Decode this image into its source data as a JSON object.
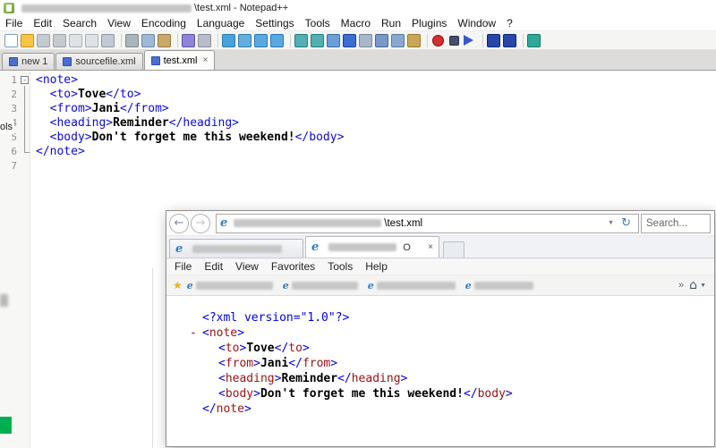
{
  "window": {
    "title_suffix": "\\test.xml - Notepad++"
  },
  "npp": {
    "menus": [
      "File",
      "Edit",
      "Search",
      "View",
      "Encoding",
      "Language",
      "Settings",
      "Tools",
      "Macro",
      "Run",
      "Plugins",
      "Window",
      "?"
    ],
    "toolbar": [
      {
        "name": "new-file",
        "c": "#fefefe",
        "b": "#7f9db9"
      },
      {
        "name": "open-folder",
        "c": "#f7c645",
        "b": "#c89018"
      },
      {
        "name": "save",
        "c": "#c4cad0",
        "b": "#9aa2aa"
      },
      {
        "name": "save-all",
        "c": "#c4cad0",
        "b": "#9aa2aa"
      },
      {
        "name": "close",
        "c": "#dfe3e7",
        "b": "#a8b0b8"
      },
      {
        "name": "close-all",
        "c": "#dfe3e7",
        "b": "#a8b0b8"
      },
      {
        "name": "print",
        "c": "#bfcad4",
        "b": "#8c98a4"
      },
      {
        "sep": true
      },
      {
        "name": "cut",
        "c": "#aab4bd",
        "b": "#7e8890"
      },
      {
        "name": "copy",
        "c": "#9fb8d8",
        "b": "#6f88a8"
      },
      {
        "name": "paste",
        "c": "#c9a86a",
        "b": "#987840"
      },
      {
        "sep": true
      },
      {
        "name": "undo",
        "c": "#8f84d8",
        "b": "#5f54a8"
      },
      {
        "name": "redo",
        "c": "#b9bdc9",
        "b": "#898d99"
      },
      {
        "sep": true
      },
      {
        "name": "find",
        "c": "#4aa3d8",
        "b": "#2a7ba8"
      },
      {
        "name": "replace",
        "c": "#63aede",
        "b": "#337ea8"
      },
      {
        "name": "zoom-in",
        "c": "#5aa8e0",
        "b": "#2a78b0"
      },
      {
        "name": "zoom-out",
        "c": "#5aa8e0",
        "b": "#2a78b0"
      },
      {
        "sep": true
      },
      {
        "name": "sync-vertical-scroll",
        "c": "#52b0b0",
        "b": "#228080"
      },
      {
        "name": "sync-horizontal-scroll",
        "c": "#52b0b0",
        "b": "#228080"
      },
      {
        "name": "word-wrap",
        "c": "#6a9fd8",
        "b": "#3a6fa8"
      },
      {
        "name": "show-all-characters",
        "c": "#3a6fd0",
        "b": "#1a3fa0"
      },
      {
        "name": "indent-guide",
        "c": "#a8b8c8",
        "b": "#788898"
      },
      {
        "name": "document-map",
        "c": "#7898c8",
        "b": "#486898"
      },
      {
        "name": "function-list",
        "c": "#88a8d0",
        "b": "#5878a0"
      },
      {
        "name": "folder-as-workspace",
        "c": "#c8a858",
        "b": "#987828"
      },
      {
        "sep": true
      },
      {
        "name": "macro-record",
        "c": "#d03030",
        "b": "#a00000",
        "shape": "circle"
      },
      {
        "name": "macro-stop",
        "c": "#46506a",
        "b": "#26304a",
        "shape": "square-small"
      },
      {
        "name": "macro-play",
        "c": "#3858c8",
        "b": "#0828a8",
        "shape": "triangle"
      },
      {
        "sep": true
      },
      {
        "name": "macro-save",
        "c": "#2848a8",
        "b": "#082878"
      },
      {
        "name": "macro-run-multiple",
        "c": "#2848a8",
        "b": "#082878"
      },
      {
        "sep": true
      },
      {
        "name": "monitoring",
        "c": "#30a898",
        "b": "#107868"
      }
    ],
    "tabs": [
      {
        "label": "new 1",
        "active": false
      },
      {
        "label": "sourcefile.xml",
        "active": false
      },
      {
        "label": "test.xml",
        "active": true
      }
    ],
    "editor_lines": [
      {
        "n": "1",
        "fold": "-",
        "tok": [
          [
            "tag",
            "<note>"
          ]
        ]
      },
      {
        "n": "2",
        "tok": [
          [
            "pl",
            "  "
          ],
          [
            "tag",
            "<to>"
          ],
          [
            "txt",
            "Tove"
          ],
          [
            "tag",
            "</to>"
          ]
        ]
      },
      {
        "n": "3",
        "tok": [
          [
            "pl",
            "  "
          ],
          [
            "tag",
            "<from>"
          ],
          [
            "txt",
            "Jani"
          ],
          [
            "tag",
            "</from>"
          ]
        ]
      },
      {
        "n": "4",
        "tok": [
          [
            "pl",
            "  "
          ],
          [
            "tag",
            "<heading>"
          ],
          [
            "txt",
            "Reminder"
          ],
          [
            "tag",
            "</heading>"
          ]
        ]
      },
      {
        "n": "5",
        "tok": [
          [
            "pl",
            "  "
          ],
          [
            "tag",
            "<body>"
          ],
          [
            "txt",
            "Don't forget me this weekend!"
          ],
          [
            "tag",
            "</body>"
          ]
        ]
      },
      {
        "n": "6",
        "tok": [
          [
            "tag",
            "</note>"
          ]
        ]
      },
      {
        "n": "7",
        "tok": []
      }
    ]
  },
  "fragments": {
    "menu_text": "ols"
  },
  "ie": {
    "back_glyph": "←",
    "forward_glyph": "→",
    "address_suffix": "\\test.xml",
    "dropdown_glyph": "▼",
    "refresh_glyph": "↻",
    "search_placeholder": "Search...",
    "menus": [
      "File",
      "Edit",
      "View",
      "Favorites",
      "Tools",
      "Help"
    ],
    "tabs": [
      {
        "blur_w": 100,
        "tail": "",
        "active": false
      },
      {
        "blur_w": 76,
        "tail": "O",
        "active": true
      }
    ],
    "favorites": [
      {
        "blur_w": 86
      },
      {
        "blur_w": 74
      },
      {
        "blur_w": 88
      },
      {
        "blur_w": 66
      }
    ],
    "favstar_glyph": "★",
    "chevron_glyph": "»",
    "home_glyph": "⌂",
    "close_glyph": "×",
    "xml_lines": [
      {
        "ind": 0,
        "tok": [
          [
            "pi",
            "<?xml version=\"1.0\"?>"
          ]
        ]
      },
      {
        "ind": 0,
        "dash": "-",
        "tok": [
          [
            "b",
            "<"
          ],
          [
            "nm",
            "note"
          ],
          [
            "b",
            ">"
          ]
        ]
      },
      {
        "ind": 1,
        "tok": [
          [
            "b",
            "<"
          ],
          [
            "nm",
            "to"
          ],
          [
            "b",
            ">"
          ],
          [
            "x",
            "Tove"
          ],
          [
            "b",
            "</"
          ],
          [
            "nm",
            "to"
          ],
          [
            "b",
            ">"
          ]
        ]
      },
      {
        "ind": 1,
        "tok": [
          [
            "b",
            "<"
          ],
          [
            "nm",
            "from"
          ],
          [
            "b",
            ">"
          ],
          [
            "x",
            "Jani"
          ],
          [
            "b",
            "</"
          ],
          [
            "nm",
            "from"
          ],
          [
            "b",
            ">"
          ]
        ]
      },
      {
        "ind": 1,
        "tok": [
          [
            "b",
            "<"
          ],
          [
            "nm",
            "heading"
          ],
          [
            "b",
            ">"
          ],
          [
            "x",
            "Reminder"
          ],
          [
            "b",
            "</"
          ],
          [
            "nm",
            "heading"
          ],
          [
            "b",
            ">"
          ]
        ]
      },
      {
        "ind": 1,
        "tok": [
          [
            "b",
            "<"
          ],
          [
            "nm",
            "body"
          ],
          [
            "b",
            ">"
          ],
          [
            "x",
            "Don't forget me this weekend!"
          ],
          [
            "b",
            "</"
          ],
          [
            "nm",
            "body"
          ],
          [
            "b",
            ">"
          ]
        ]
      },
      {
        "ind": 0,
        "tok": [
          [
            "b",
            "</"
          ],
          [
            "nm",
            "note"
          ],
          [
            "b",
            ">"
          ]
        ]
      }
    ]
  }
}
